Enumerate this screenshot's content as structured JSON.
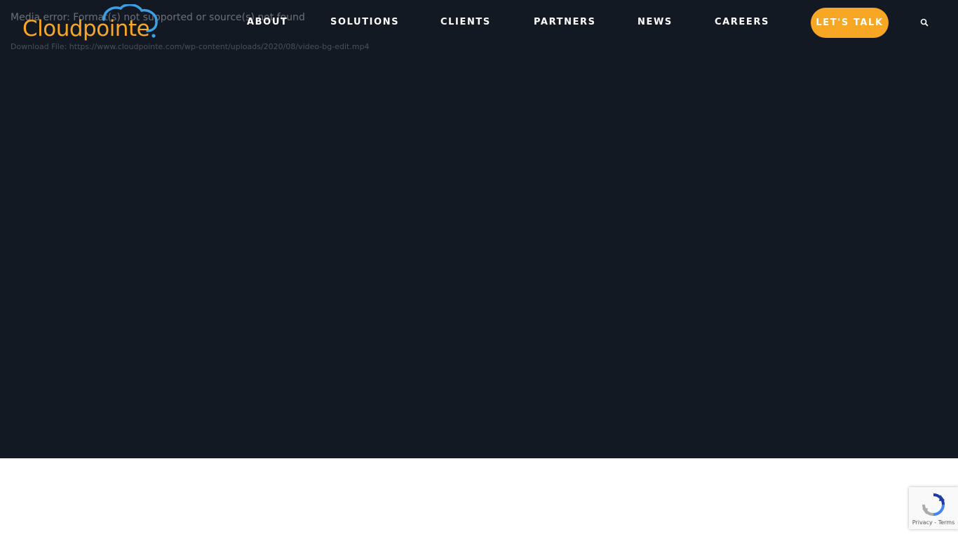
{
  "media": {
    "error_text": "Media error: Format(s) not supported or source(s) not found",
    "download_label": "Download File:",
    "download_url": "https://www.cloudpointe.com/wp-content/uploads/2020/08/video-bg-edit.mp4"
  },
  "brand": {
    "name": "Cloudpointe",
    "primary_color": "#f7a723",
    "accent_color": "#3aa0e8",
    "hero_background": "#131923"
  },
  "nav": {
    "items": [
      {
        "label": "ABOUT"
      },
      {
        "label": "SOLUTIONS"
      },
      {
        "label": "CLIENTS"
      },
      {
        "label": "PARTNERS"
      },
      {
        "label": "NEWS"
      },
      {
        "label": "CAREERS"
      }
    ],
    "cta_label": "LET'S TALK",
    "search_icon": "search-icon"
  },
  "recaptcha": {
    "links": "Privacy - Terms",
    "icon": "recaptcha-icon"
  }
}
